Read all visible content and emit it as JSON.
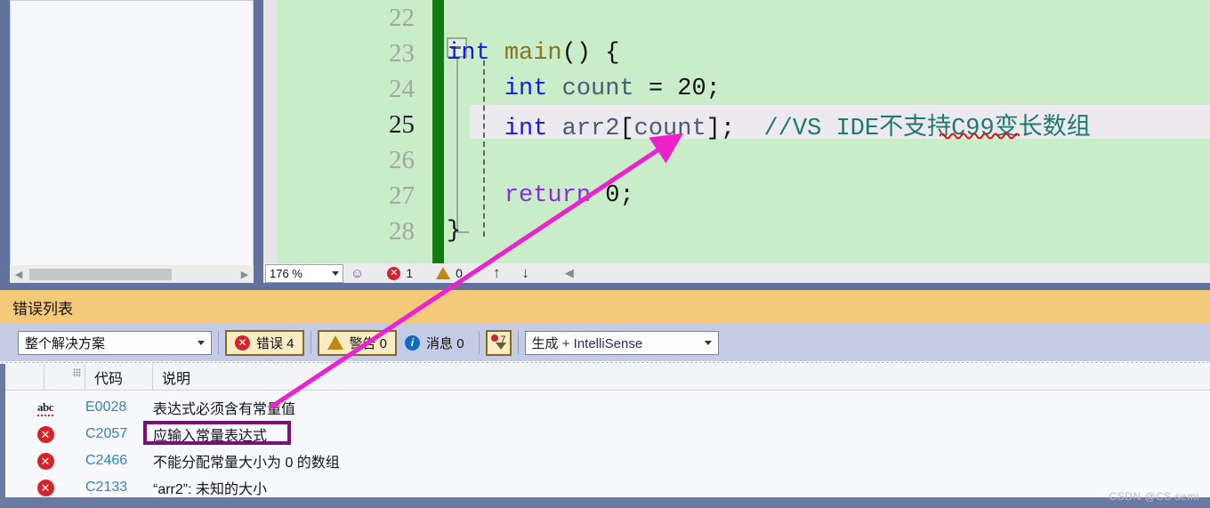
{
  "editor": {
    "lines": [
      {
        "no": "22",
        "current": false,
        "tokens": []
      },
      {
        "no": "23",
        "current": false,
        "tokens": [
          {
            "t": "int",
            "c": "kw"
          },
          {
            "t": " ",
            "c": "plain"
          },
          {
            "t": "main",
            "c": "fn"
          },
          {
            "t": "() {",
            "c": "plain"
          }
        ]
      },
      {
        "no": "24",
        "current": false,
        "tokens": [
          {
            "t": "    ",
            "c": "plain"
          },
          {
            "t": "int",
            "c": "kw"
          },
          {
            "t": " ",
            "c": "plain"
          },
          {
            "t": "count",
            "c": "ident"
          },
          {
            "t": " = ",
            "c": "plain"
          },
          {
            "t": "20",
            "c": "num"
          },
          {
            "t": ";",
            "c": "plain"
          }
        ]
      },
      {
        "no": "25",
        "current": true,
        "tokens": [
          {
            "t": "    ",
            "c": "plain"
          },
          {
            "t": "int",
            "c": "kw"
          },
          {
            "t": " ",
            "c": "plain"
          },
          {
            "t": "arr2",
            "c": "ident"
          },
          {
            "t": "[",
            "c": "plain"
          },
          {
            "t": "count",
            "c": "ident"
          },
          {
            "t": "];  ",
            "c": "plain"
          },
          {
            "t": "//VS IDE不支持C99变长数组",
            "c": "cmt"
          }
        ]
      },
      {
        "no": "26",
        "current": false,
        "tokens": []
      },
      {
        "no": "27",
        "current": false,
        "tokens": [
          {
            "t": "    ",
            "c": "plain"
          },
          {
            "t": "return",
            "c": "kw2"
          },
          {
            "t": " ",
            "c": "plain"
          },
          {
            "t": "0",
            "c": "num"
          },
          {
            "t": ";",
            "c": "plain"
          }
        ]
      },
      {
        "no": "28",
        "current": false,
        "tokens": [
          {
            "t": "}",
            "c": "plain"
          }
        ]
      }
    ],
    "status": {
      "zoom_level": "176 %",
      "error_count": "1",
      "warning_count": "0",
      "error_badge_glyph": "✕",
      "warning_badge_glyph": "!",
      "nav_up_glyph": "↑",
      "nav_down_glyph": "↓",
      "collapse_caret_glyph": "◀",
      "intellisense_icon": "intellisense-bulb-icon"
    }
  },
  "left_panel": {
    "scroll_left_glyph": "◀",
    "scroll_right_glyph": "▶"
  },
  "error_list": {
    "title": "错误列表",
    "toolbar": {
      "scope_value": "整个解决方案",
      "errors_label": "错误 4",
      "warnings_label": "警告 0",
      "messages_label": "消息 0",
      "filter_badge": "7",
      "build_filter_a": "生成",
      "build_filter_b": " + IntelliSense",
      "caret_glyph": "▼"
    },
    "columns": [
      "",
      "",
      "代码",
      "说明"
    ],
    "rows": [
      {
        "icon": "spellcheck-abc-icon",
        "code": "E0028",
        "desc": "表达式必须含有常量值",
        "highlighted": false
      },
      {
        "icon": "error-x-icon",
        "code": "C2057",
        "desc": "应输入常量表达式",
        "highlighted": true
      },
      {
        "icon": "error-x-icon",
        "code": "C2466",
        "desc": "不能分配常量大小为 0 的数组",
        "highlighted": false
      },
      {
        "icon": "error-x-icon",
        "code": "C2133",
        "desc": "“arr2”: 未知的大小",
        "highlighted": false
      }
    ]
  },
  "annotation": {
    "arrow_color": "#ee22cc",
    "highlight_box_color": "#7b0f7b"
  },
  "watermark": {
    "text": "CSDN @CS semi"
  }
}
